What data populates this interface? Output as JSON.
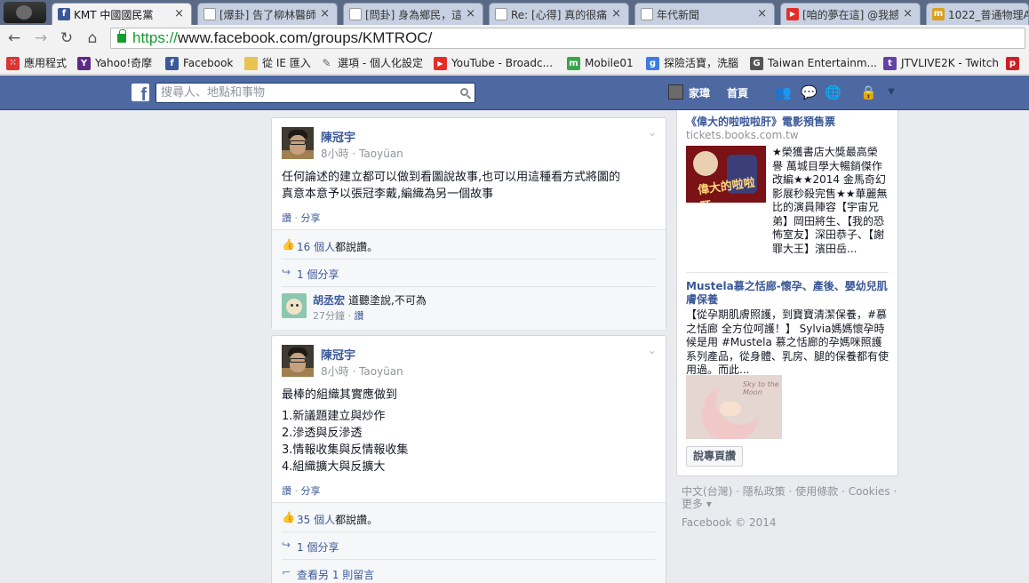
{
  "browser": {
    "tabs": [
      {
        "label": "KMT 中國國民黨",
        "favicon": "facebook-icon",
        "active": true
      },
      {
        "label": "[爆卦] 告了柳林醫師",
        "favicon": "page-icon",
        "active": false
      },
      {
        "label": "[問卦] 身為鄉民，這",
        "favicon": "page-icon",
        "active": false
      },
      {
        "label": "Re: [心得] 真的很痛",
        "favicon": "page-icon",
        "active": false
      },
      {
        "label": "年代新聞",
        "favicon": "page-icon",
        "active": false
      },
      {
        "label": "[咱的夢在這] @我撼",
        "favicon": "youtube-icon",
        "active": false
      },
      {
        "label": "1022_普通物理A(",
        "favicon": "moodle-icon",
        "active": false
      }
    ],
    "close_glyph": "×",
    "nav": {
      "back": "←",
      "forward": "→",
      "reload": "↻",
      "home": "⌂"
    },
    "url_scheme": "https://",
    "url_rest": "www.facebook.com/groups/KMTROC/",
    "bookmarks": [
      {
        "label": "應用程式",
        "icon": "apps-grid-icon"
      },
      {
        "label": "Yahoo!奇摩",
        "icon": "yahoo-icon"
      },
      {
        "label": "Facebook",
        "icon": "facebook-icon"
      },
      {
        "label": "從 IE 匯入",
        "icon": "folder-icon"
      },
      {
        "label": "選項 - 個人化設定",
        "icon": "wrench-icon"
      },
      {
        "label": "YouTube - Broadc...",
        "icon": "youtube-icon"
      },
      {
        "label": "Mobile01",
        "icon": "mobile01-icon"
      },
      {
        "label": "探險活寶，洗腦",
        "icon": "google-icon"
      },
      {
        "label": "Taiwan Entertainm...",
        "icon": "page-icon"
      },
      {
        "label": "JTVLIVE2K - Twitch",
        "icon": "twitch-icon"
      }
    ]
  },
  "fb": {
    "search_placeholder": "搜尋人、地點和事物",
    "user_name": "家瑋",
    "home_label": "首頁"
  },
  "posts": [
    {
      "author": "陳冠宇",
      "meta": "8小時 · Taoyüan",
      "lines": [
        "任何論述的建立都可以做到看圖說故事,也可以用這種看方式將圖的",
        "真意本意予以張冠李戴,編織為另一個故事"
      ],
      "actions": {
        "like": "讚",
        "sep": " · ",
        "share": "分享"
      },
      "likes_count": "16 個人",
      "likes_suffix": "都說讚。",
      "shares": "1 個分享",
      "comment": {
        "name": "胡丞宏",
        "text": "道聽塗說,不可為",
        "time": "27分鐘",
        "sep": " · ",
        "like": "讚"
      }
    },
    {
      "author": "陳冠宇",
      "meta": "8小時 · Taoyüan",
      "lines": [
        "最棒的組織其實應做到",
        "1.新議題建立與炒作",
        "2.滲透與反滲透",
        "3.情報收集與反情報收集",
        "4.組織擴大與反擴大"
      ],
      "actions": {
        "like": "讚",
        "sep": " · ",
        "share": "分享"
      },
      "likes_count": "35 個人",
      "likes_suffix": "都說讚。",
      "shares": "1 個分享",
      "more_comments": "查看另 1 則留言"
    }
  ],
  "ads": [
    {
      "title": "《偉大的啦啦啦肝》電影預售票",
      "domain": "tickets.books.com.tw",
      "image_text": "偉大的啦啦肝",
      "description": "★榮獲書店大獎最高榮譽 萬城目學大暢銷傑作改編★★2014 金馬奇幻影展秒殺完售★★華麗無比的演員陣容【宇宙兄弟】岡田將生、【我的恐怖室友】深田恭子、【謝罪大王】濱田岳..."
    },
    {
      "title": "Mustela慕之恬廊-懷孕、產後、嬰幼兒肌膚保養",
      "image_text": "Sky to the Moon",
      "description": "【從孕期肌膚照護，到寶寶清潔保養，#慕之恬廊 全方位呵護！】 Sylvia媽媽懷孕時候是用 #Mustela 慕之恬廊的孕媽咪照護系列產品，從身體、乳房、腿的保養都有使用過。而此...",
      "button": "說專頁讚"
    }
  ],
  "footer": {
    "line1": "中文(台灣) · 隱私政策 · 使用條款 · Cookies ·",
    "line2": "更多 ▾",
    "copyright": "Facebook © 2014"
  }
}
